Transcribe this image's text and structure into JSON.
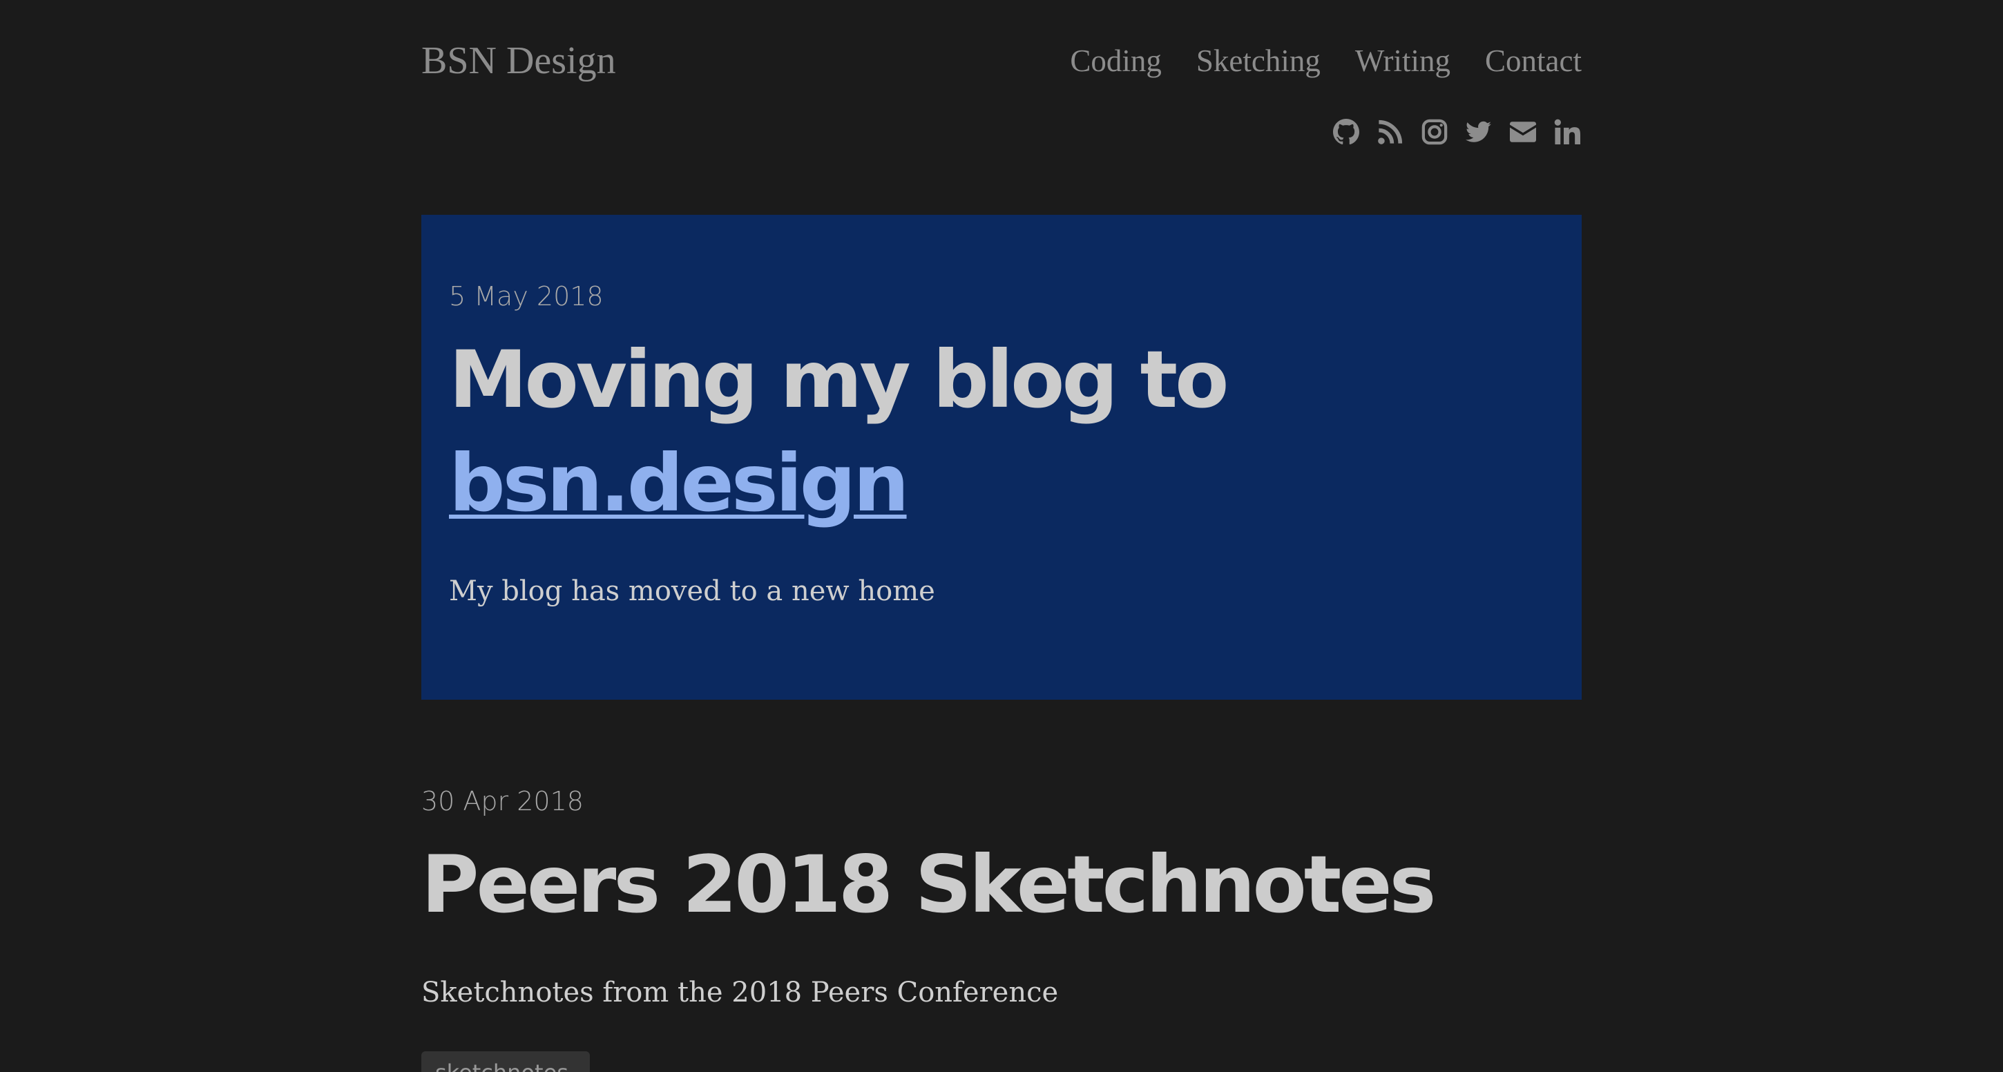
{
  "header": {
    "site_title": "BSN Design",
    "nav": [
      {
        "label": "Coding"
      },
      {
        "label": "Sketching"
      },
      {
        "label": "Writing"
      },
      {
        "label": "Contact"
      }
    ],
    "social_icons": [
      "github-icon",
      "rss-icon",
      "instagram-icon",
      "twitter-icon",
      "envelope-icon",
      "linkedin-icon"
    ],
    "link_color": "#8c8c8c"
  },
  "featured_post": {
    "date": "5 May 2018",
    "title_prefix": "Moving my blog to",
    "title_link": "bsn.design",
    "summary": "My blog has moved to a new home",
    "background": "#0b2960",
    "link_color": "#8fb0ee"
  },
  "posts": [
    {
      "date": "30 Apr 2018",
      "title": "Peers 2018 Sketchnotes",
      "summary": "Sketchnotes from the 2018 Peers Conference",
      "tag": "sketchnotes"
    }
  ],
  "colors": {
    "page_background": "#1b1b1b",
    "heading": "#cccccc",
    "body_text": "#cfcfcf",
    "muted": "#a8a8a8"
  }
}
